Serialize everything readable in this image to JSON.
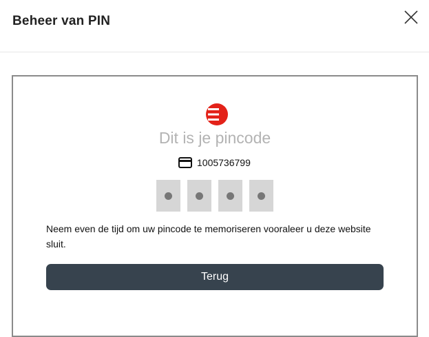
{
  "dialog": {
    "title": "Beheer van PIN",
    "close_icon": "close-icon"
  },
  "content": {
    "logo_icon": "brand-logo",
    "heading": "Dit is je pincode",
    "card_icon": "credit-card-icon",
    "card_number": "1005736799",
    "pin_digits_masked": 4,
    "message": "Neem even de tijd om uw pincode te memoriseren vooraleer u deze website sluit.",
    "back_label": "Terug"
  },
  "colors": {
    "brand_red": "#e32219",
    "button_bg": "#37434e",
    "heading_gray": "#b3b3b3",
    "pin_box": "#d6d6d6"
  }
}
